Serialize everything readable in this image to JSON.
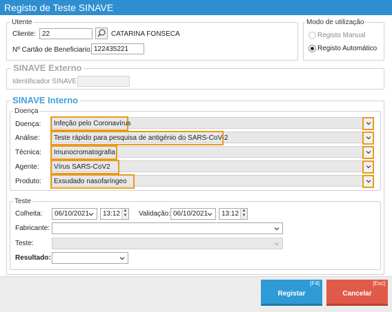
{
  "window": {
    "title": "Registo de Teste SINAVE"
  },
  "utente": {
    "legend": "Utente",
    "cliente_label": "Cliente:",
    "cliente_value": "22",
    "cliente_name": "CATARINA FONSECA",
    "cartao_label": "Nº Cartão de Beneficiario:",
    "cartao_value": "122435221"
  },
  "modo": {
    "legend": "Modo de utilização",
    "manual_label": "Registo Manual",
    "automatico_label": "Registo Automático",
    "selected": "Registo Automático"
  },
  "externo": {
    "title": "SINAVE Externo",
    "identificador_label": "Identificador SINAVE:",
    "identificador_value": ""
  },
  "interno": {
    "title": "SINAVE Interno",
    "doenca_group": "Doença",
    "fields": [
      {
        "label": "Doença:",
        "value": "Infeção pelo Coronavírus"
      },
      {
        "label": "Análise:",
        "value": "Teste rápido para pesquisa de antigénio do SARS-CoV-2"
      },
      {
        "label": "Técnica:",
        "value": "Imunocromatografia"
      },
      {
        "label": "Agente:",
        "value": "Vírus SARS-CoV2"
      },
      {
        "label": "Produto:",
        "value": "Exsudado nasofaríngeo"
      }
    ]
  },
  "teste": {
    "legend": "Teste",
    "colheita_label": "Colheita:",
    "colheita_date": "06/10/2021",
    "colheita_time": "13:12",
    "validacao_label": "Validação:",
    "validacao_date": "06/10/2021",
    "validacao_time": "13:12",
    "fabricante_label": "Fabricante:",
    "fabricante_value": "",
    "teste_label": "Teste:",
    "teste_value": "",
    "resultado_label": "Resultado:",
    "resultado_value": ""
  },
  "footer": {
    "registar_label": "Registar",
    "registar_key": "[F4]",
    "cancelar_label": "Cancelar",
    "cancelar_key": "[Esc]"
  },
  "colors": {
    "titlebar": "#2e8ecf",
    "highlight": "#e89a1a",
    "primary": "#2e9ad6",
    "danger": "#e05a4a"
  }
}
